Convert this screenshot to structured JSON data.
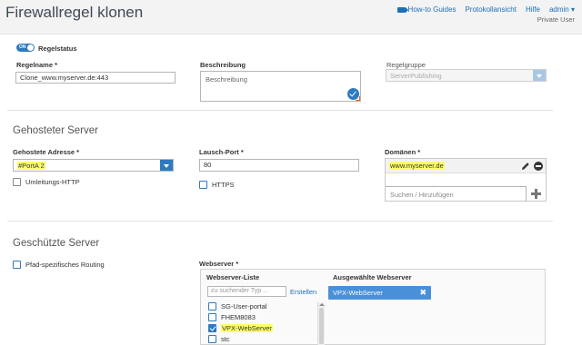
{
  "header": {
    "title": "Firewallregel klonen",
    "links": {
      "guides": "How-to Guides",
      "log": "Protokollansicht",
      "help": "Hilfe",
      "admin": "admin ▾"
    },
    "user": "Private User"
  },
  "rule": {
    "toggle_text": "ON",
    "status_label": "Regelstatus",
    "name_label": "Regelname *",
    "name_value": "Clone_www.myserver.de:443",
    "description_label": "Beschreibung",
    "description_placeholder": "Beschreibung",
    "group_label": "Regelgruppe",
    "group_value": "ServerPublishing"
  },
  "hosted": {
    "section_title": "Gehosteter Server",
    "address_label": "Gehostete Adresse *",
    "address_value": "#PortA 2",
    "redirect_label": "Umleitungs-HTTP",
    "port_label": "Lausch-Port *",
    "port_value": "80",
    "https_label": "HTTPS",
    "domains_label": "Domänen *",
    "domain_value": "www.myserver.de",
    "domain_search_placeholder": "Suchen / Hinzufügen"
  },
  "protected": {
    "section_title": "Geschützte Server",
    "path_routing_label": "Pfad-spezifisches Routing",
    "webserver_label": "Webserver *",
    "list_title": "Webserver-Liste",
    "search_placeholder": "zu suchender Typ ...",
    "create_label": "Erstellen",
    "items": [
      {
        "label": "SG-User-portal",
        "checked": false
      },
      {
        "label": "FHEM8083",
        "checked": false
      },
      {
        "label": "VPX-WebServer",
        "checked": true
      },
      {
        "label": "stc",
        "checked": false
      }
    ],
    "selected_title": "Ausgewählte Webserver",
    "selected_items": [
      "VPX-WebServer"
    ]
  },
  "colors": {
    "accent": "#2d7ac1",
    "highlight": "#ffff66",
    "header_bg": "#f3f3f3"
  },
  "icons": [
    "video-icon",
    "check-circle-icon",
    "pencil-icon",
    "minus-circle-icon",
    "plus-icon",
    "close-icon",
    "chevron-down-icon"
  ]
}
